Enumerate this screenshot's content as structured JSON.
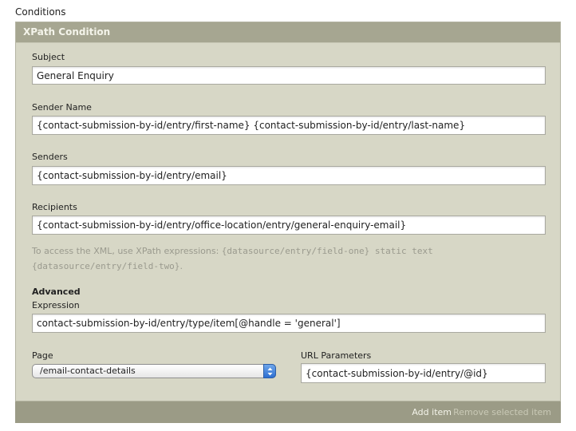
{
  "section": {
    "label": "Conditions"
  },
  "panel": {
    "title": "XPath Condition"
  },
  "fields": {
    "subject": {
      "label": "Subject",
      "value": "General Enquiry"
    },
    "sender_name": {
      "label": "Sender Name",
      "value": "{contact-submission-by-id/entry/first-name} {contact-submission-by-id/entry/last-name}"
    },
    "senders": {
      "label": "Senders",
      "value": "{contact-submission-by-id/entry/email}"
    },
    "recipients": {
      "label": "Recipients",
      "value": "{contact-submission-by-id/entry/office-location/entry/general-enquiry-email}"
    }
  },
  "help": {
    "prefix": "To access the XML, use XPath expressions: ",
    "code1": "{datasource/entry/field-one}",
    "middle": " static text ",
    "code2": "{datasource/entry/field-two}",
    "suffix": "."
  },
  "advanced": {
    "title": "Advanced",
    "expression": {
      "label": "Expression",
      "value": "contact-submission-by-id/entry/type/item[@handle = 'general']"
    },
    "page": {
      "label": "Page",
      "selected": "/email-contact-details"
    },
    "url_params": {
      "label": "URL Parameters",
      "value": "{contact-submission-by-id/entry/@id}"
    }
  },
  "footer": {
    "add_label": "Add item",
    "remove_label": "Remove selected item"
  },
  "colors": {
    "panel_bg": "#d7d7c6",
    "header_bg": "#a6a691",
    "footer_bg": "#9b9b86",
    "select_accent": "#2d6fd1"
  }
}
